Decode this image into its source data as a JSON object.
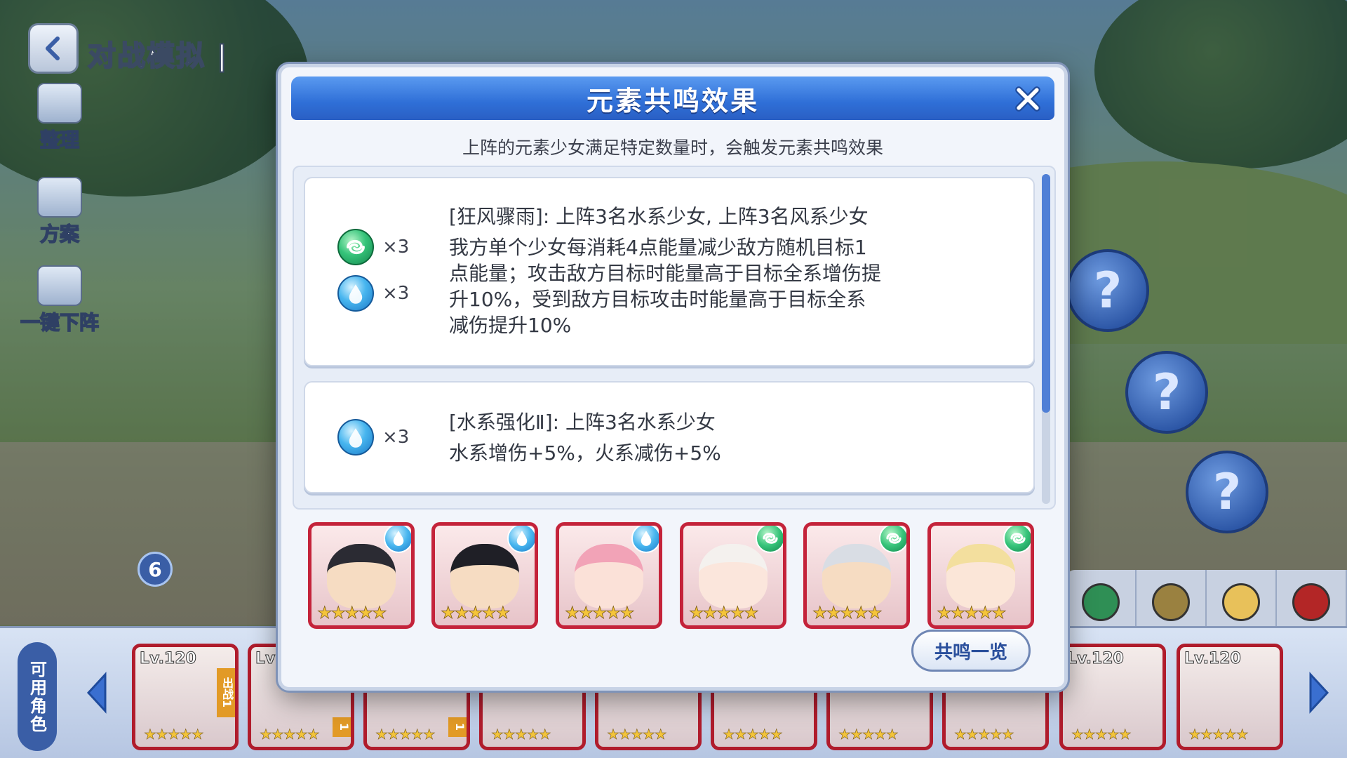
{
  "page": {
    "title": "对战模拟",
    "title_suffix": "|",
    "side_tools": [
      {
        "label": "整理",
        "icon": "organize-icon"
      },
      {
        "label": "方案",
        "icon": "plans-icon"
      },
      {
        "label": "一键下阵",
        "icon": "remove-all-icon"
      }
    ],
    "team_count": "6",
    "mystery_mark": "?"
  },
  "modal": {
    "title": "元素共鸣效果",
    "subtitle": "上阵的元素少女满足特定数量时，会触发元素共鸣效果",
    "effects": [
      {
        "requirements": [
          {
            "element": "wind",
            "count": "×3"
          },
          {
            "element": "water",
            "count": "×3"
          }
        ],
        "name": "[狂风骤雨]: 上阵3名水系少女, 上阵3名风系少女",
        "description": "我方单个少女每消耗4点能量减少敌方随机目标1\n点能量；攻击敌方目标时能量高于目标全系增伤提\n升10%，受到敌方目标攻击时能量高于目标全系\n减伤提升10%"
      },
      {
        "requirements": [
          {
            "element": "water",
            "count": "×3"
          }
        ],
        "name": "[水系强化Ⅱ]: 上阵3名水系少女",
        "description": "水系增伤+5%，火系减伤+5%"
      }
    ],
    "team": [
      {
        "element": "water",
        "stars": "★★★★★"
      },
      {
        "element": "water",
        "stars": "★★★★★"
      },
      {
        "element": "water",
        "stars": "★★★★★"
      },
      {
        "element": "wind",
        "stars": "★★★★★"
      },
      {
        "element": "wind",
        "stars": "★★★★★"
      },
      {
        "element": "wind",
        "stars": "★★★★★"
      }
    ],
    "resonance_button": "共鸣一览"
  },
  "roster": {
    "tab_label": "可用角色",
    "cards": [
      {
        "level": "Lv.120",
        "tag": "出战1",
        "stars": "★★★★★"
      },
      {
        "level": "Lv",
        "tag": "1",
        "stars": "★★★★★"
      },
      {
        "level": "",
        "tag": "1",
        "stars": "★★★★★"
      },
      {
        "level": "",
        "tag": "",
        "stars": "★★★★★"
      },
      {
        "level": "",
        "tag": "",
        "stars": "★★★★★"
      },
      {
        "level": "",
        "tag": "",
        "stars": "★★★★★"
      },
      {
        "level": "",
        "tag": "",
        "stars": "★★★★★"
      },
      {
        "level": "",
        "tag": "",
        "stars": "★★★★★"
      },
      {
        "level": "Lv.120",
        "tag": "",
        "stars": "★★★★★"
      },
      {
        "level": "Lv.120",
        "tag": "",
        "stars": "★★★★★"
      }
    ]
  },
  "colors": {
    "modal_header": "#2f6fd7",
    "card_border": "#c4233a",
    "water": "#48b6ef",
    "wind": "#36c47a"
  }
}
